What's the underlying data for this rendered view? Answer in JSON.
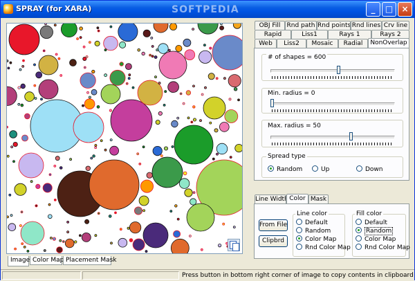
{
  "window": {
    "title": "SPRAY (for XARA)",
    "watermark": "SOFTPEDIA",
    "buttons": {
      "minimize": "_",
      "maximize": "□",
      "close": "×"
    }
  },
  "image_tabs": [
    "Image",
    "Color Map",
    "Placement Mask"
  ],
  "shape_tabs": {
    "row1": [
      "OBJ Fill",
      "Rnd path",
      "Rnd points",
      "Rnd lines",
      "Crv line"
    ],
    "row2": [
      "Rapid",
      "Liss1",
      "Rays 1",
      "Rays 2"
    ],
    "row3": [
      "Web",
      "Liss2",
      "Mosaic",
      "Radial",
      "NonOverlap"
    ],
    "active": "NonOverlap"
  },
  "sliders": {
    "shapes": {
      "label": "# of shapes = 600",
      "fraction": 0.55
    },
    "min_radius": {
      "label": "Min. radius = 0",
      "fraction": 0.0
    },
    "max_radius": {
      "label": "Max. radius = 50",
      "fraction": 0.65
    }
  },
  "spread": {
    "label": "Spread type",
    "options": [
      "Random",
      "Up",
      "Down"
    ],
    "selected": "Random"
  },
  "style_tabs": {
    "items": [
      "Line Width",
      "Color",
      "Mask"
    ],
    "active": "Color"
  },
  "buttons": {
    "from_file": "From File",
    "clipbrd": "Clipbrd"
  },
  "line_color": {
    "label": "Line color",
    "options": [
      "Default",
      "Random",
      "Color Map",
      "Rnd Color Map"
    ],
    "selected": "Color Map"
  },
  "fill_color": {
    "label": "Fill color",
    "options": [
      "Default",
      "Random",
      "Color Map",
      "Rnd Color Map"
    ],
    "selected": "Random"
  },
  "status": "Press button in bottom right corner of image to copy contents in clipboard",
  "colors": {
    "title_blue": "#0054e3",
    "panel_bg": "#ece9d8",
    "radio_dot": "#21a121"
  },
  "icons": {
    "app": "spray-app-icon",
    "copy": "copy-to-clipboard-icon"
  }
}
